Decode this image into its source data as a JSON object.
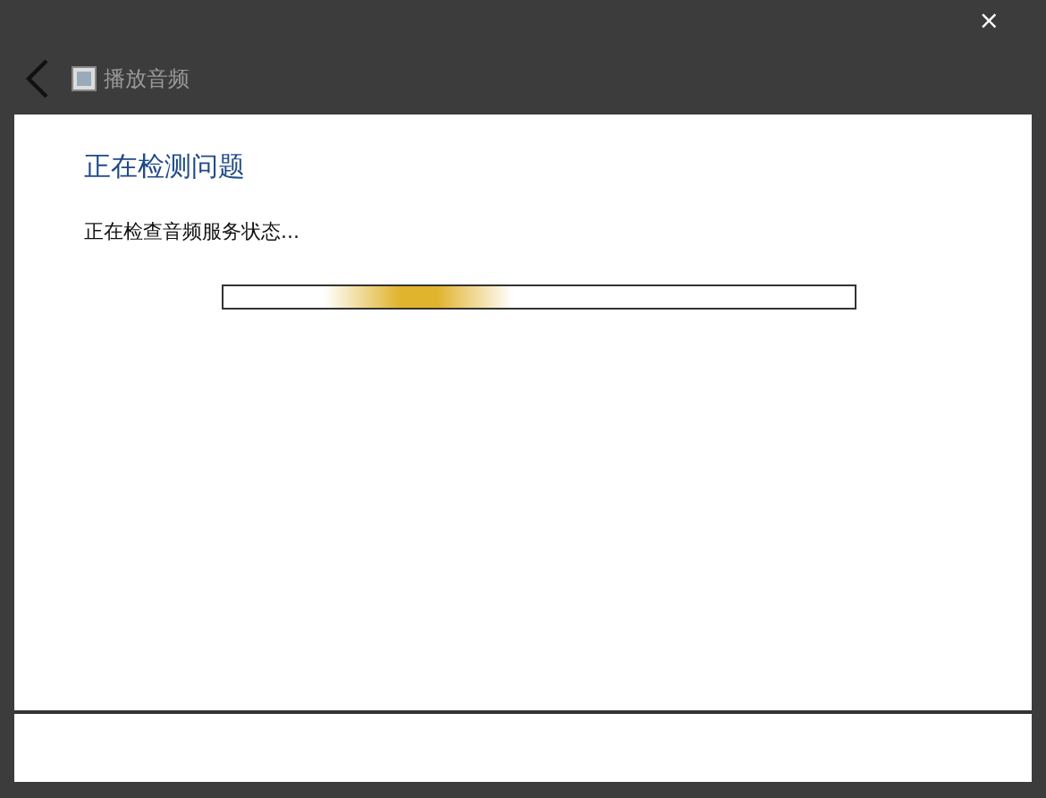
{
  "window": {
    "title": "播放音频",
    "close": "×"
  },
  "heading": "正在检测问题",
  "status": "正在检查音频服务状态...",
  "progress": {
    "indeterminate": true
  }
}
